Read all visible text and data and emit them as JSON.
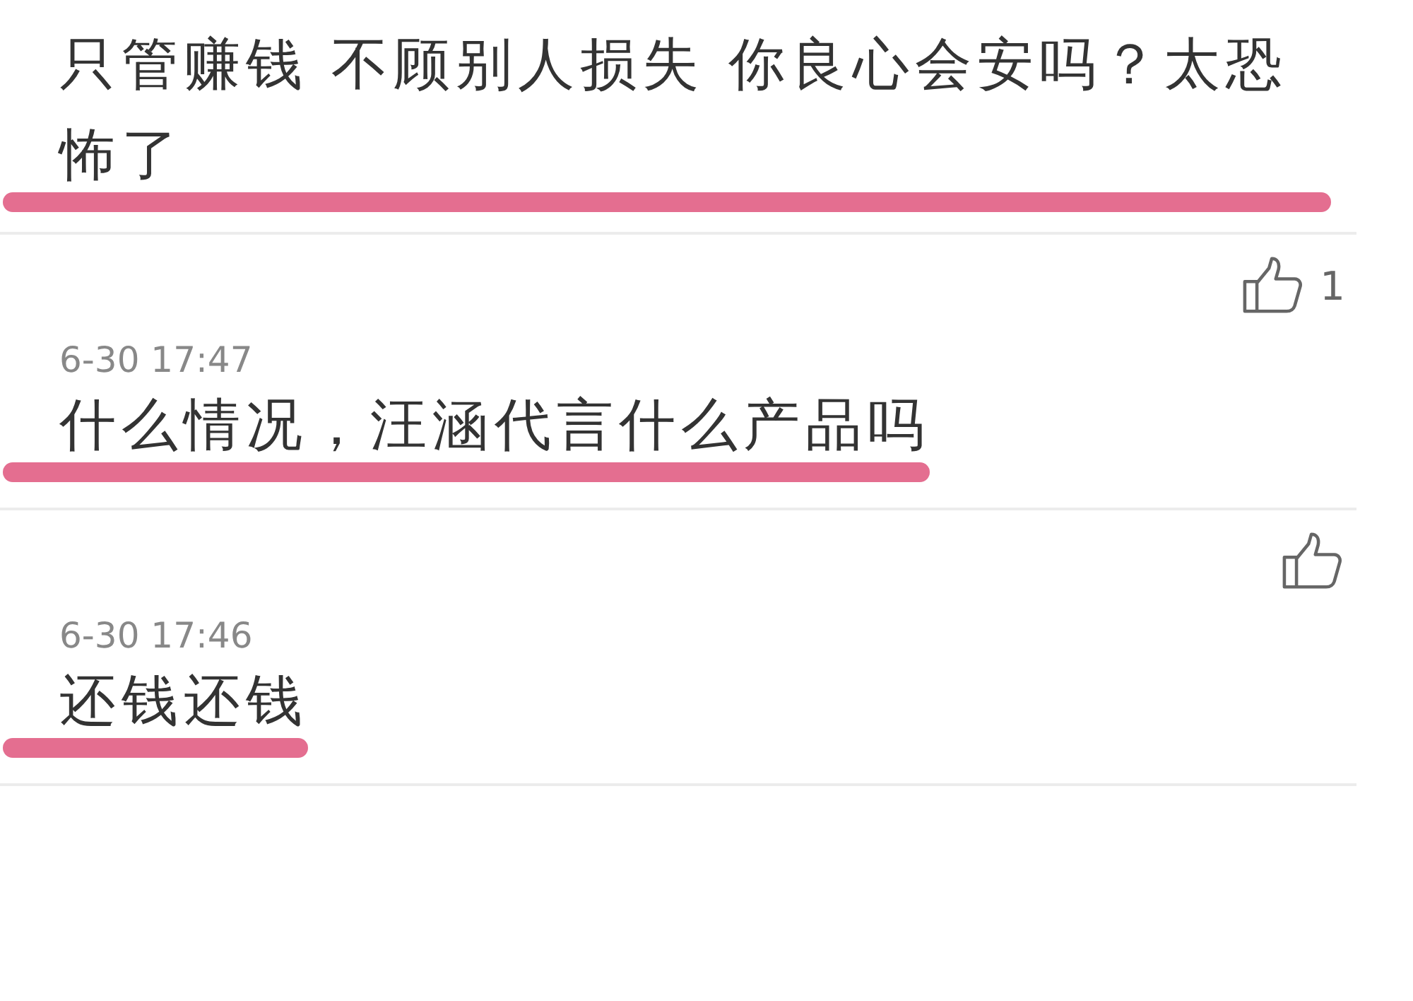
{
  "comments": [
    {
      "text": "只管赚钱 不顾别人损失 你良心会安吗？太恐怖了",
      "highlighted": true
    },
    {
      "time": "6-30 17:47",
      "likes": "1",
      "text": "什么情况，汪涵代言什么产品吗",
      "highlighted": true
    },
    {
      "time": "6-30 17:46",
      "text": "还钱还钱",
      "highlighted": true
    }
  ]
}
